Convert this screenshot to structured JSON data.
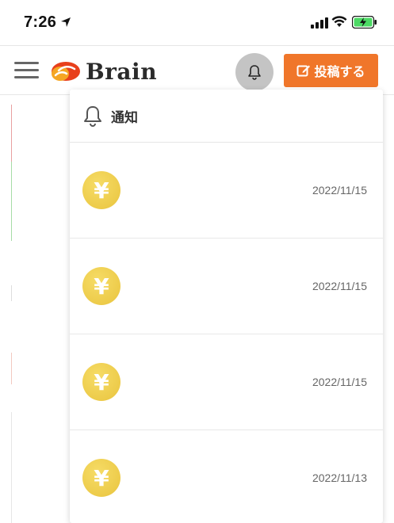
{
  "status_bar": {
    "time": "7:26"
  },
  "header": {
    "logo_text": "Brain",
    "post_button_label": "投稿する"
  },
  "notification_panel": {
    "title": "通知",
    "items": [
      {
        "icon": "yen-coin-icon",
        "date": "2022/11/15"
      },
      {
        "icon": "yen-coin-icon",
        "date": "2022/11/15"
      },
      {
        "icon": "yen-coin-icon",
        "date": "2022/11/15"
      },
      {
        "icon": "yen-coin-icon",
        "date": "2022/11/13"
      }
    ]
  },
  "colors": {
    "accent": "#f0762a",
    "coin": "#f2d04f",
    "bell_button_bg": "#c4c4c4"
  }
}
